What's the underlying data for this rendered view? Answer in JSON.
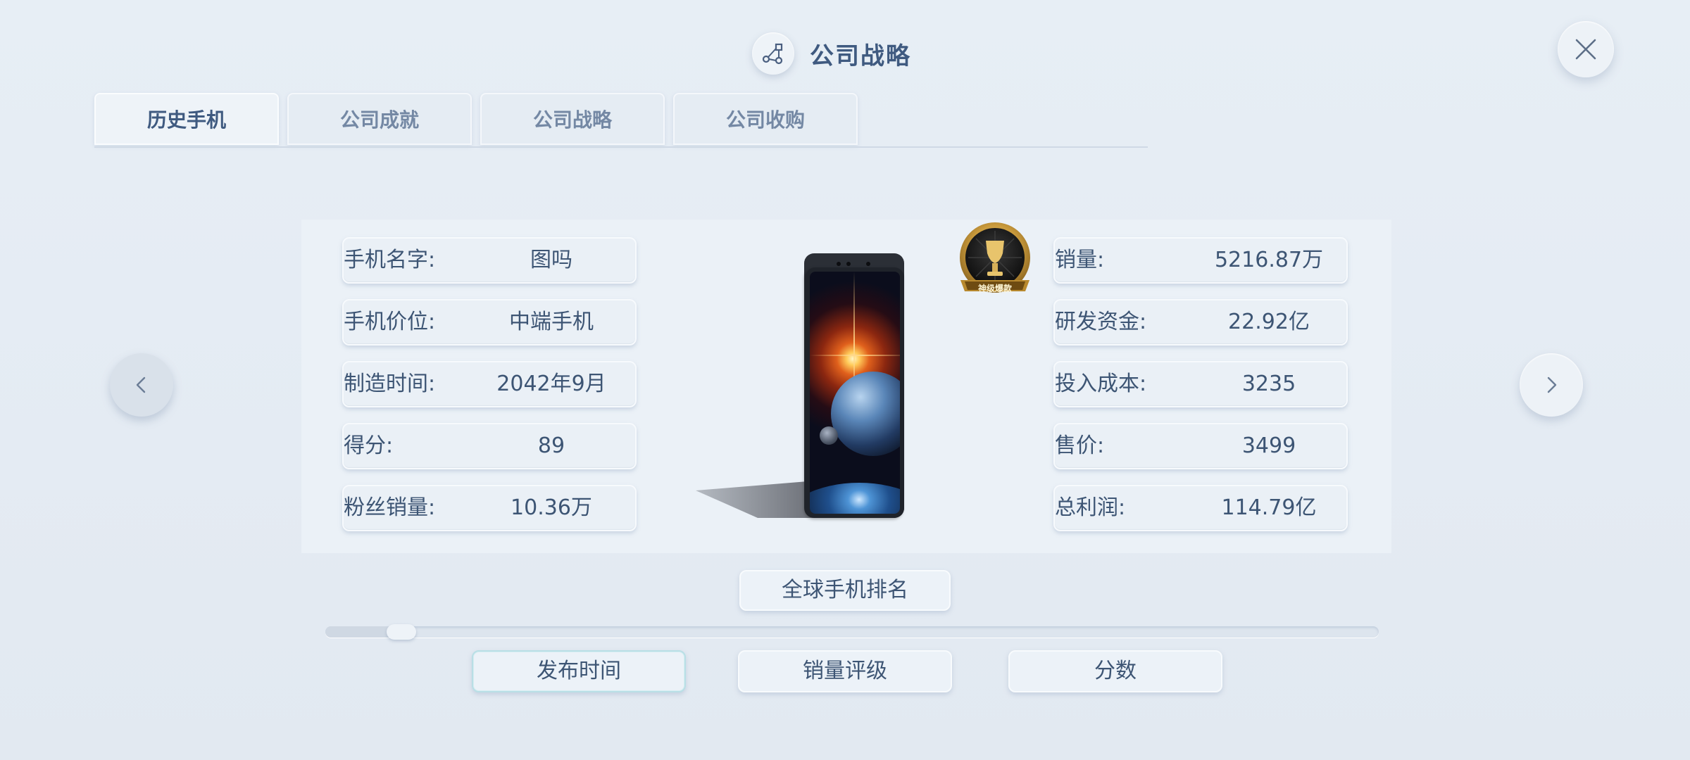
{
  "header": {
    "title": "公司战略",
    "icon": "strategy-node-icon"
  },
  "close": {
    "icon": "close-icon"
  },
  "tabs": [
    {
      "label": "历史手机",
      "active": true
    },
    {
      "label": "公司成就",
      "active": false
    },
    {
      "label": "公司战略",
      "active": false
    },
    {
      "label": "公司收购",
      "active": false
    }
  ],
  "phone_info": {
    "left": [
      {
        "label": "手机名字:",
        "value": "图吗"
      },
      {
        "label": "手机价位:",
        "value": "中端手机"
      },
      {
        "label": "制造时间:",
        "value": "2042年9月"
      },
      {
        "label": "得分:",
        "value": "89"
      },
      {
        "label": "粉丝销量:",
        "value": "10.36万"
      }
    ],
    "right": [
      {
        "label": "销量:",
        "value": "5216.87万"
      },
      {
        "label": "研发资金:",
        "value": "22.92亿"
      },
      {
        "label": "投入成本:",
        "value": "3235"
      },
      {
        "label": "售价:",
        "value": "3499"
      },
      {
        "label": "总利润:",
        "value": "114.79亿"
      }
    ]
  },
  "badge": {
    "text": "神级爆款",
    "icon": "trophy-badge-icon"
  },
  "nav": {
    "prev_icon": "chevron-left-icon",
    "next_icon": "chevron-right-icon"
  },
  "ranking_button": {
    "label": "全球手机排名"
  },
  "slider": {
    "value": 0.06
  },
  "sort_buttons": [
    {
      "label": "发布时间",
      "active": true
    },
    {
      "label": "销量评级",
      "active": false
    },
    {
      "label": "分数",
      "active": false
    }
  ],
  "colors": {
    "accent_text": "#3f5a80",
    "active_sort_border": "#b9dfe6"
  }
}
